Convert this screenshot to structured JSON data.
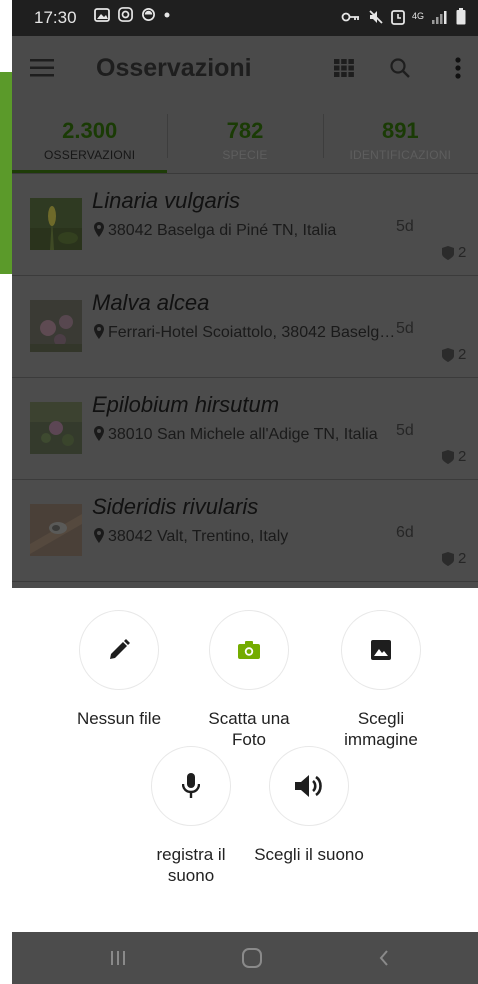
{
  "status_bar": {
    "time": "17:30",
    "network": "4G"
  },
  "app_bar": {
    "title": "Osservazioni"
  },
  "stats": [
    {
      "value": "2.300",
      "label": "OSSERVAZIONI",
      "active": true
    },
    {
      "value": "782",
      "label": "SPECIE",
      "active": false
    },
    {
      "value": "891",
      "label": "IDENTIFICAZIONI",
      "active": false
    }
  ],
  "observations": [
    {
      "name": "Linaria vulgaris",
      "place": "38042 Baselga di Piné TN, Italia",
      "age": "5d",
      "ids": "2"
    },
    {
      "name": "Malva alcea",
      "place": "Ferrari-Hotel Scoiattolo, 38042 Baselg…",
      "age": "5d",
      "ids": "2"
    },
    {
      "name": "Epilobium hirsutum",
      "place": "38010 San Michele all'Adige TN, Italia",
      "age": "5d",
      "ids": "2"
    },
    {
      "name": "Sideridis rivularis",
      "place": "38042 Valt, Trentino, Italy",
      "age": "6d",
      "ids": "2"
    }
  ],
  "sheet": {
    "no_file": "Nessun file",
    "take_photo": "Scatta una Foto",
    "choose_image": "Scegli immagine",
    "record_sound": "registra il suono",
    "choose_sound": "Scegli il suono"
  },
  "colors": {
    "accent": "#74ac00",
    "left_strip": "#5b9a2a",
    "overlay_bg": "#4a4a4a",
    "stat_number": "#1a3b05"
  },
  "icons": {
    "status": [
      "gallery-icon",
      "instagram-icon",
      "sync-icon",
      "dot-icon",
      "key-icon",
      "mute-icon",
      "alarm-icon",
      "4g-icon",
      "signal-icon",
      "battery-icon"
    ],
    "app_bar": [
      "menu-icon",
      "grid-icon",
      "search-icon",
      "more-vert-icon"
    ],
    "sheet": [
      "pencil-icon",
      "camera-icon",
      "image-icon",
      "microphone-icon",
      "speaker-icon"
    ],
    "nav": [
      "recents-icon",
      "home-icon",
      "back-icon"
    ]
  }
}
